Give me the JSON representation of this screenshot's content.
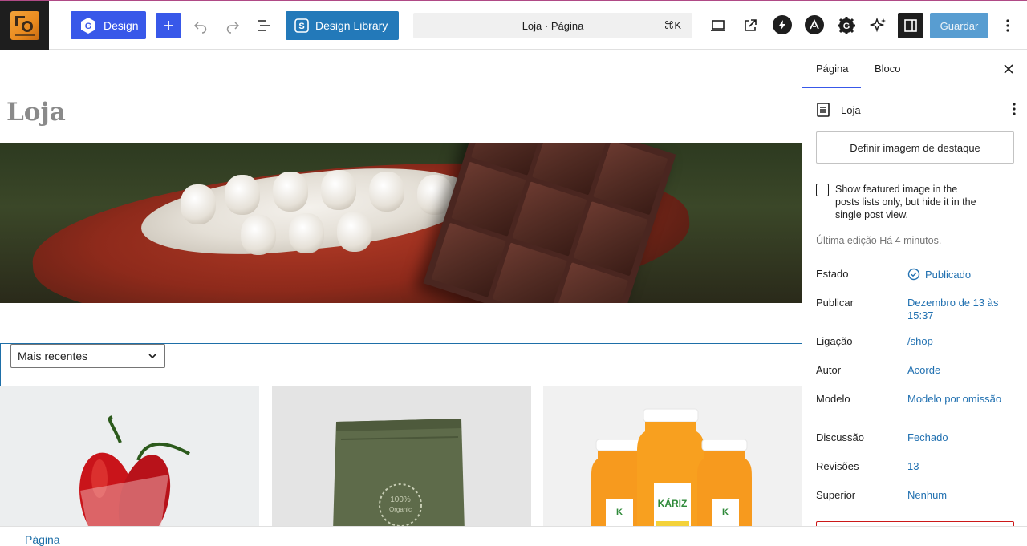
{
  "toolbar": {
    "design_label": "Design",
    "library_label": "Design Library",
    "command_title": "Loja · Página",
    "command_shortcut": "⌘K",
    "save_label": "Guardar"
  },
  "canvas": {
    "page_title": "Loja",
    "sort_select_value": "Mais recentes"
  },
  "sidebar": {
    "tabs": [
      {
        "label": "Página",
        "active": true
      },
      {
        "label": "Bloco",
        "active": false
      }
    ],
    "doc_title": "Loja",
    "featured_image_button": "Definir imagem de destaque",
    "checkbox_label": "Show featured image in the posts lists only, but hide it in the single post view.",
    "last_edited": "Última edição Há 4 minutos.",
    "properties": [
      {
        "label": "Estado",
        "value": "Publicado"
      },
      {
        "label": "Publicar",
        "value": "Dezembro de 13 às 15:37"
      },
      {
        "label": "Ligação",
        "value": "/shop"
      },
      {
        "label": "Autor",
        "value": "Acorde"
      },
      {
        "label": "Modelo",
        "value": "Modelo por omissão"
      },
      {
        "label": "Discussão",
        "value": "Fechado"
      },
      {
        "label": "Revisões",
        "value": "13"
      },
      {
        "label": "Superior",
        "value": "Nenhum"
      }
    ]
  },
  "statusbar": {
    "breadcrumb": "Página"
  },
  "colors": {
    "accent": "#3858e9",
    "library_button": "#2379b9",
    "link": "#2271b1",
    "save_button": "#3b8dc9"
  }
}
